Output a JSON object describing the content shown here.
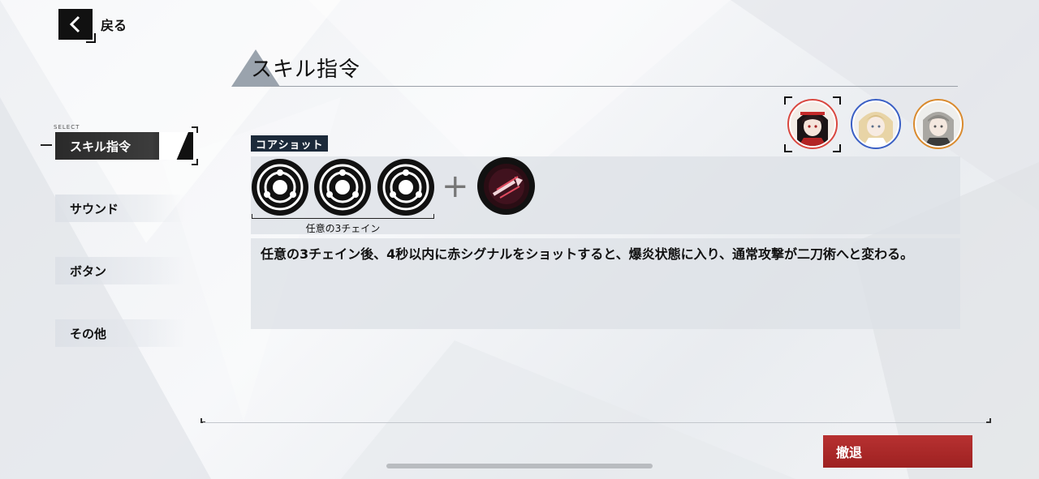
{
  "header": {
    "back_label": "戻る",
    "title": "スキル指令"
  },
  "sidebar": {
    "select_tag": "SELECT",
    "items": [
      {
        "label": "スキル指令",
        "active": true
      },
      {
        "label": "サウンド",
        "active": false
      },
      {
        "label": "ボタン",
        "active": false
      },
      {
        "label": "その他",
        "active": false
      }
    ]
  },
  "skill": {
    "core_tag": "コアショット",
    "chain_label": "任意の3チェイン",
    "plus_symbol": "+",
    "description": "任意の3チェイン後、4秒以内に赤シグナルをショットすると、爆炎状態に入り、通常攻撃が二刀術へと変わる。",
    "icons": [
      "chain-signal-icon",
      "chain-signal-icon",
      "chain-signal-icon",
      "red-sword-shot-icon"
    ]
  },
  "characters": [
    {
      "name": "red-hair-character-avatar",
      "ring_color": "#d9473f",
      "selected": true
    },
    {
      "name": "blonde-character-avatar",
      "ring_color": "#3a5fc4",
      "selected": false
    },
    {
      "name": "gray-hair-character-avatar",
      "ring_color": "#d98a2e",
      "selected": false
    }
  ],
  "footer": {
    "exit_label": "撤退"
  },
  "colors": {
    "accent_red": "#a82626",
    "core_tag_bg": "#1c2a3a"
  }
}
